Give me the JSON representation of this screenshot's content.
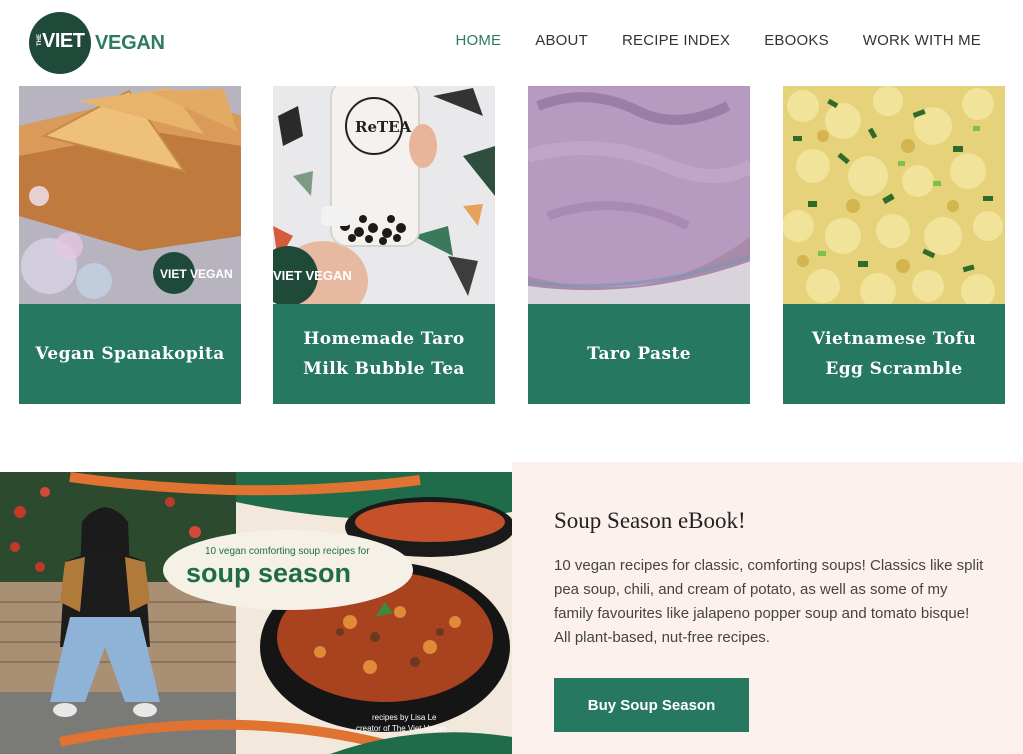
{
  "logo": {
    "the": "THE",
    "viet": "VIET",
    "vegan": "VEGAN"
  },
  "nav": {
    "items": [
      {
        "label": "HOME",
        "active": true
      },
      {
        "label": "ABOUT"
      },
      {
        "label": "RECIPE INDEX"
      },
      {
        "label": "EBOOKS"
      },
      {
        "label": "WORK WITH ME"
      }
    ]
  },
  "recipes": [
    {
      "title": "Vegan Spanakopita",
      "badge": "VIET VEGAN"
    },
    {
      "title": "Homemade Taro Milk Bubble Tea",
      "badge": "VIET VEGAN",
      "cup_text": "ReTEA"
    },
    {
      "title": "Taro Paste"
    },
    {
      "title": "Vietnamese Tofu Egg Scramble"
    }
  ],
  "promo": {
    "cover_subtitle": "10 vegan comforting soup recipes for",
    "cover_title": "soup season",
    "cover_credit_1": "recipes by Lisa Le",
    "cover_credit_2": "creator of The Viet Vegan",
    "title": "Soup Season eBook!",
    "text": "10 vegan recipes for classic, comforting soups! Classics like split pea soup, chili, and cream of potato, as well as some of my family favourites like jalapeno popper soup and tomato bisque! All plant-based, nut-free recipes.",
    "button": "Buy Soup Season"
  },
  "colors": {
    "brand_green": "#267860",
    "dark_green": "#1f4a3a",
    "promo_bg": "#fdf1ee"
  }
}
